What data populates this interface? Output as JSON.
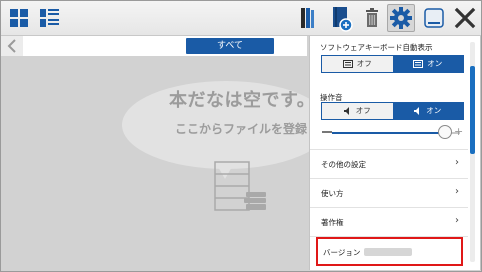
{
  "toolbar": {
    "icons": [
      "grid-view-icon",
      "list-view-icon",
      "bookshelf-icon",
      "add-book-icon",
      "trash-icon",
      "gear-icon",
      "minimize-icon",
      "close-icon"
    ]
  },
  "filter": {
    "all_label": "すべて"
  },
  "empty": {
    "title": "本だなは空です。",
    "subtitle": "ここからファイルを登録しまし"
  },
  "settings": {
    "keyboard_label": "ソフトウェアキーボード自動表示",
    "keyboard_off": "オフ",
    "keyboard_on": "オン",
    "keyboard_selected": "オン",
    "sound_label": "操作音",
    "sound_off": "オフ",
    "sound_on": "オン",
    "sound_selected": "オン",
    "volume_level": 0.88,
    "menu": [
      {
        "label": "その他の設定",
        "chevron": "›"
      },
      {
        "label": "使い方",
        "chevron": "›"
      },
      {
        "label": "著作権",
        "chevron": "›"
      }
    ],
    "version_label": "バージョン"
  },
  "colors": {
    "accent": "#1a5ba6",
    "highlight": "#e01818"
  }
}
